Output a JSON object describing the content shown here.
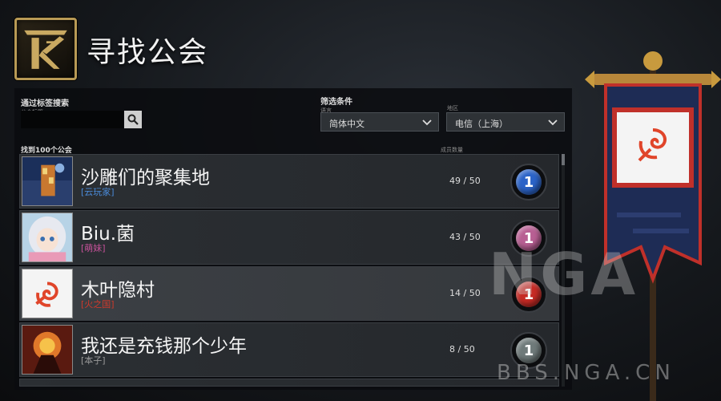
{
  "header": {
    "title": "寻找公会"
  },
  "search": {
    "label": "通过标签搜索",
    "sublabel": "公会标签",
    "value": ""
  },
  "filters": {
    "label": "筛选条件",
    "language_label": "语言",
    "language_value": "简体中文",
    "region_label": "地区",
    "region_value": "电信（上海）"
  },
  "list": {
    "found_text": "找到100个公会",
    "members_header": "成员数量",
    "guilds": [
      {
        "name": "沙雕们的聚集地",
        "tag": "[云玩家]",
        "tag_color": "#4a8ad8",
        "count": "49 / 50",
        "level": "1",
        "badge_color": "#2b63c7"
      },
      {
        "name": "Biu.菌",
        "tag": "[萌妹]",
        "tag_color": "#c6529a",
        "count": "43 / 50",
        "level": "1",
        "badge_color": "#b85f93"
      },
      {
        "name": "木叶隐村",
        "tag": "[火之国]",
        "tag_color": "#d0392b",
        "count": "14 / 50",
        "level": "1",
        "badge_color": "#c62a25"
      },
      {
        "name": "我还是充钱那个少年",
        "tag": "[本子]",
        "tag_color": "#9a9a9a",
        "count": "8 / 50",
        "level": "1",
        "badge_color": "#6f7a7a"
      }
    ]
  },
  "watermark": {
    "text": "NGA",
    "url": "BBS.NGA.CN"
  }
}
